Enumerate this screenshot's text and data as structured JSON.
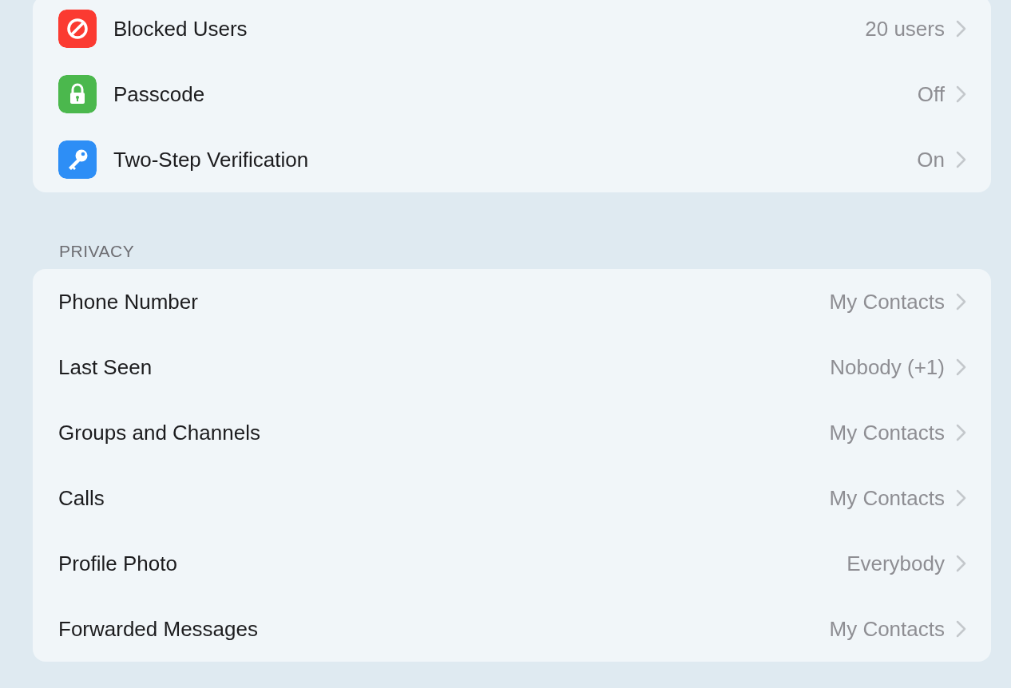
{
  "security": {
    "items": [
      {
        "label": "Blocked Users",
        "value": "20 users",
        "kind": "blocked",
        "color": "#fb3a31"
      },
      {
        "label": "Passcode",
        "value": "Off",
        "kind": "lock",
        "color": "#4bb84d"
      },
      {
        "label": "Two-Step Verification",
        "value": "On",
        "kind": "key",
        "color": "#2d8ef6"
      }
    ]
  },
  "privacy": {
    "header": "PRIVACY",
    "items": [
      {
        "label": "Phone Number",
        "value": "My Contacts"
      },
      {
        "label": "Last Seen",
        "value": "Nobody (+1)"
      },
      {
        "label": "Groups and Channels",
        "value": "My Contacts"
      },
      {
        "label": "Calls",
        "value": "My Contacts"
      },
      {
        "label": "Profile Photo",
        "value": "Everybody"
      },
      {
        "label": "Forwarded Messages",
        "value": "My Contacts"
      }
    ]
  }
}
